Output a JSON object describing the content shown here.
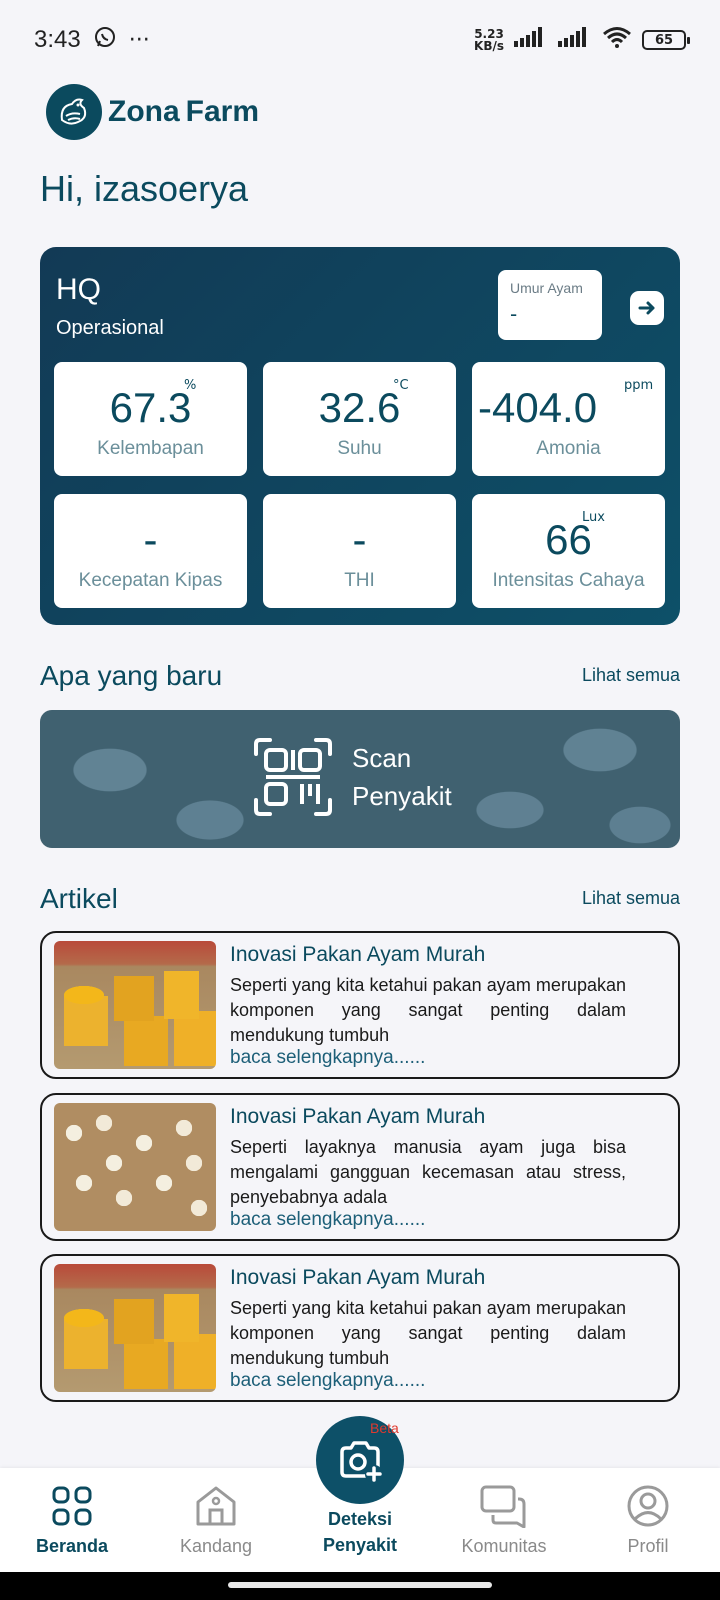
{
  "status_bar": {
    "time": "3:43",
    "more": "···",
    "net_speed_value": "5.23",
    "net_speed_unit": "KB/s",
    "battery": "65"
  },
  "app": {
    "logo_text_1": "Zona",
    "logo_text_2": "Farm",
    "brand_color": "#0b4a5e"
  },
  "greeting": "Hi, izasoerya",
  "farm_card": {
    "name": "HQ",
    "type": "Operasional",
    "age_label": "Umur Ayam",
    "age_value": "-",
    "metrics": [
      {
        "value": "67.3",
        "unit": "%",
        "label": "Kelembapan"
      },
      {
        "value": "32.6",
        "unit": "°C",
        "label": "Suhu"
      },
      {
        "value": "-404.0",
        "unit": "ppm",
        "label": "Amonia"
      },
      {
        "value": "-",
        "unit": "",
        "label": "Kecepatan Kipas"
      },
      {
        "value": "-",
        "unit": "",
        "label": "THI"
      },
      {
        "value": "66",
        "unit": "Lux",
        "label": "Intensitas Cahaya"
      }
    ]
  },
  "whats_new": {
    "title": "Apa yang baru",
    "see_all": "Lihat semua",
    "banner_line1": "Scan",
    "banner_line2": "Penyakit"
  },
  "articles": {
    "title": "Artikel",
    "see_all": "Lihat semua",
    "items": [
      {
        "title": "Inovasi Pakan Ayam Murah",
        "excerpt": "Seperti yang kita ketahui pakan ayam merupakan komponen yang sangat penting dalam mendukung tumbuh",
        "more": "baca selengkapnya......",
        "image": "feeder-image"
      },
      {
        "title": "Inovasi Pakan Ayam Murah",
        "excerpt": "Seperti layaknya manusia ayam juga bisa mengalami gangguan kecemasan atau stress, penyebabnya adala",
        "more": "baca selengkapnya......",
        "image": "chicks-image"
      },
      {
        "title": "Inovasi Pakan Ayam Murah",
        "excerpt": "Seperti yang kita ketahui pakan ayam merupakan komponen yang sangat penting dalam mendukung tumbuh",
        "more": "baca selengkapnya......",
        "image": "feeder-image"
      }
    ]
  },
  "bottom_nav": {
    "items": [
      {
        "label": "Beranda",
        "icon": "grid-icon",
        "active": true
      },
      {
        "label": "Kandang",
        "icon": "barn-icon",
        "active": false
      },
      {
        "label": "Komunitas",
        "icon": "chat-icon",
        "active": false
      },
      {
        "label": "Profil",
        "icon": "profile-icon",
        "active": false
      }
    ],
    "fab_badge": "Beta",
    "fab_label_1": "Deteksi",
    "fab_label_2": "Penyakit",
    "fab_icon": "camera-plus-icon"
  }
}
